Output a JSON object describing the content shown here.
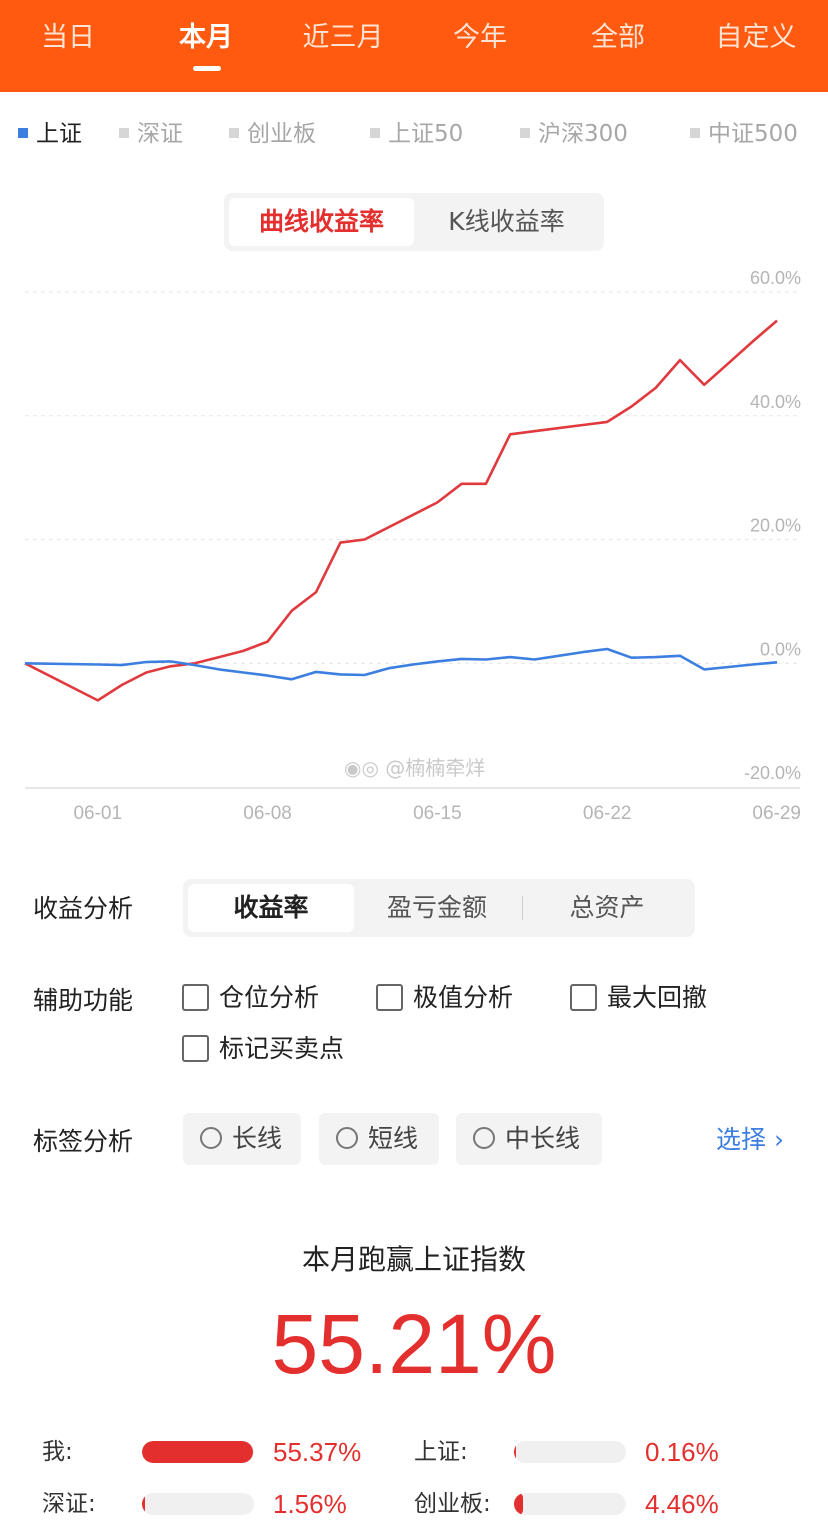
{
  "top_tabs": [
    {
      "label": "当日",
      "active": false
    },
    {
      "label": "本月",
      "active": true
    },
    {
      "label": "近三月",
      "active": false
    },
    {
      "label": "今年",
      "active": false
    },
    {
      "label": "全部",
      "active": false
    },
    {
      "label": "自定义",
      "active": false
    }
  ],
  "indices": [
    {
      "label": "上证",
      "active": true
    },
    {
      "label": "深证",
      "active": false
    },
    {
      "label": "创业板",
      "active": false
    },
    {
      "label": "上证50",
      "active": false
    },
    {
      "label": "沪深300",
      "active": false
    },
    {
      "label": "中证500",
      "active": false
    }
  ],
  "chart_type": {
    "active": "曲线收益率",
    "inactive": "K线收益率"
  },
  "chart_data": {
    "type": "line",
    "y_ticks": [
      "60.0%",
      "40.0%",
      "20.0%",
      "0.0%",
      "-20.0%"
    ],
    "x_ticks": [
      "06-01",
      "06-08",
      "06-15",
      "06-22",
      "06-29"
    ],
    "ylim": [
      -20,
      60
    ],
    "x": [
      -2,
      1,
      2,
      3,
      4,
      5,
      6,
      7,
      8,
      9,
      10,
      11,
      12,
      13,
      14,
      15,
      16,
      17,
      18,
      19,
      20,
      21,
      22,
      23,
      24,
      25,
      26,
      27,
      28,
      29
    ],
    "series": [
      {
        "color": "#e03a3e",
        "values": [
          0.0,
          -6.0,
          -3.5,
          -1.5,
          -0.5,
          0.0,
          1.0,
          2.0,
          3.5,
          8.5,
          11.5,
          19.5,
          20.0,
          22.0,
          24.0,
          26.0,
          29.0,
          29.0,
          37.0,
          37.5,
          38.0,
          38.5,
          39.0,
          41.5,
          44.5,
          49.0,
          45.0,
          48.5,
          52.0,
          55.37
        ]
      },
      {
        "color": "#3d7fe0",
        "values": [
          0.0,
          -0.2,
          -0.3,
          0.2,
          0.3,
          -0.3,
          -1.0,
          -1.5,
          -2.0,
          -2.6,
          -1.4,
          -1.8,
          -1.9,
          -0.8,
          -0.2,
          0.3,
          0.7,
          0.6,
          1.0,
          0.6,
          1.2,
          1.8,
          2.3,
          0.9,
          1.0,
          1.2,
          -1.0,
          -0.6,
          -0.2,
          0.16
        ]
      }
    ]
  },
  "watermark": "@楠楠牵烊",
  "analysis": {
    "label": "收益分析",
    "tabs": [
      "收益率",
      "盈亏金额",
      "总资产"
    ],
    "active_index": 0
  },
  "aux": {
    "label": "辅助功能",
    "options": [
      "仓位分析",
      "极值分析",
      "最大回撤",
      "标记买卖点"
    ]
  },
  "tags": {
    "label": "标签分析",
    "options": [
      "长线",
      "短线",
      "中长线"
    ],
    "select_label": "选择 ›"
  },
  "summary": {
    "title": "本月跑赢上证指数",
    "value": "55.21%"
  },
  "comparison": [
    {
      "label": "我:",
      "value": "55.37%",
      "pct": 55.37
    },
    {
      "label": "上证:",
      "value": "0.16%",
      "pct": 0.16
    },
    {
      "label": "深证:",
      "value": "1.56%",
      "pct": 1.56
    },
    {
      "label": "创业板:",
      "value": "4.46%",
      "pct": 4.46
    }
  ],
  "colors": {
    "brand": "#ff5a0f",
    "up": "#e3302f",
    "index_line": "#3d7fe0"
  }
}
